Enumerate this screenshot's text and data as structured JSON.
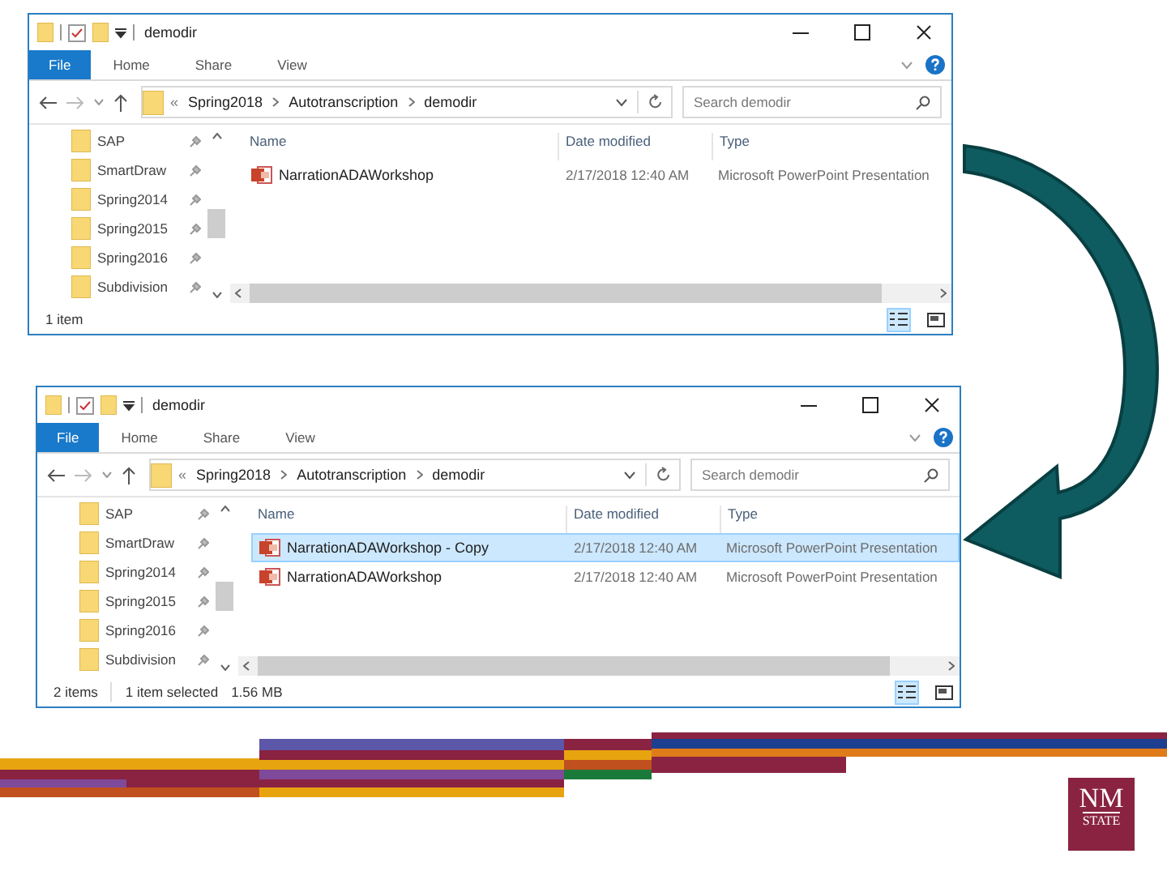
{
  "windows": [
    {
      "title": "demodir",
      "ribbon_tabs": [
        {
          "label": "File",
          "kind": "file"
        },
        {
          "label": "Home",
          "kind": "tab"
        },
        {
          "label": "Share",
          "kind": "tab"
        },
        {
          "label": "View",
          "kind": "tab"
        }
      ],
      "breadcrumb": {
        "overflow": "«",
        "parts": [
          "Spring2018",
          "Autotranscription",
          "demodir"
        ]
      },
      "search": {
        "placeholder": "Search demodir"
      },
      "nav_items": [
        "SAP",
        "SmartDraw",
        "Spring2014",
        "Spring2015",
        "Spring2016",
        "Subdivision"
      ],
      "columns": [
        "Name",
        "Date modified",
        "Type"
      ],
      "rows": [
        {
          "name": "NarrationADAWorkshop",
          "date": "2/17/2018 12:40 AM",
          "type": "Microsoft PowerPoint Presentation",
          "selected": false
        }
      ],
      "status": [
        "1 item"
      ]
    },
    {
      "title": "demodir",
      "ribbon_tabs": [
        {
          "label": "File",
          "kind": "file"
        },
        {
          "label": "Home",
          "kind": "tab"
        },
        {
          "label": "Share",
          "kind": "tab"
        },
        {
          "label": "View",
          "kind": "tab"
        }
      ],
      "breadcrumb": {
        "overflow": "«",
        "parts": [
          "Spring2018",
          "Autotranscription",
          "demodir"
        ]
      },
      "search": {
        "placeholder": "Search demodir"
      },
      "nav_items": [
        "SAP",
        "SmartDraw",
        "Spring2014",
        "Spring2015",
        "Spring2016",
        "Subdivision"
      ],
      "columns": [
        "Name",
        "Date modified",
        "Type"
      ],
      "rows": [
        {
          "name": "NarrationADAWorkshop - Copy",
          "date": "2/17/2018 12:40 AM",
          "type": "Microsoft PowerPoint Presentation",
          "selected": true
        },
        {
          "name": "NarrationADAWorkshop",
          "date": "2/17/2018 12:40 AM",
          "type": "Microsoft PowerPoint Presentation",
          "selected": false
        }
      ],
      "status": [
        "2 items",
        "1 item selected",
        "1.56 MB"
      ]
    }
  ],
  "logo": {
    "line_1": "NM",
    "line_2": "STATE"
  }
}
